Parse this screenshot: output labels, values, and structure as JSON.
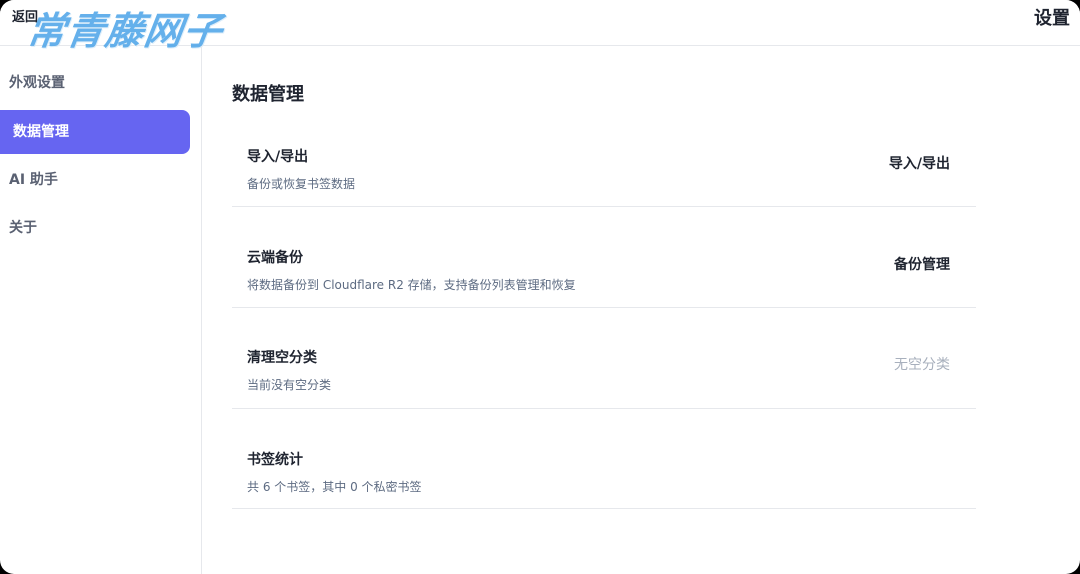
{
  "header": {
    "back_label": "返回",
    "watermark": "常青藤网子",
    "title": "设置"
  },
  "sidebar": {
    "items": [
      {
        "label": "外观设置",
        "active": false
      },
      {
        "label": "数据管理",
        "active": true
      },
      {
        "label": "AI 助手",
        "active": false
      },
      {
        "label": "关于",
        "active": false
      }
    ]
  },
  "main": {
    "section_title": "数据管理",
    "rows": [
      {
        "title": "导入/导出",
        "description": "备份或恢复书签数据",
        "action": "导入/导出",
        "action_enabled": true
      },
      {
        "title": "云端备份",
        "description": "将数据备份到 Cloudflare R2 存储，支持备份列表管理和恢复",
        "action": "备份管理",
        "action_enabled": true
      },
      {
        "title": "清理空分类",
        "description": "当前没有空分类",
        "action": "无空分类",
        "action_enabled": false
      },
      {
        "title": "书签统计",
        "description": "共 6 个书签，其中 0 个私密书签"
      }
    ]
  },
  "colors": {
    "accent": "#6665f1",
    "text_primary": "#1f2430",
    "text_secondary": "#5d6b82",
    "text_disabled": "#a8b0bd",
    "divider": "#e6e8ec",
    "watermark": "#4aa3e8"
  }
}
